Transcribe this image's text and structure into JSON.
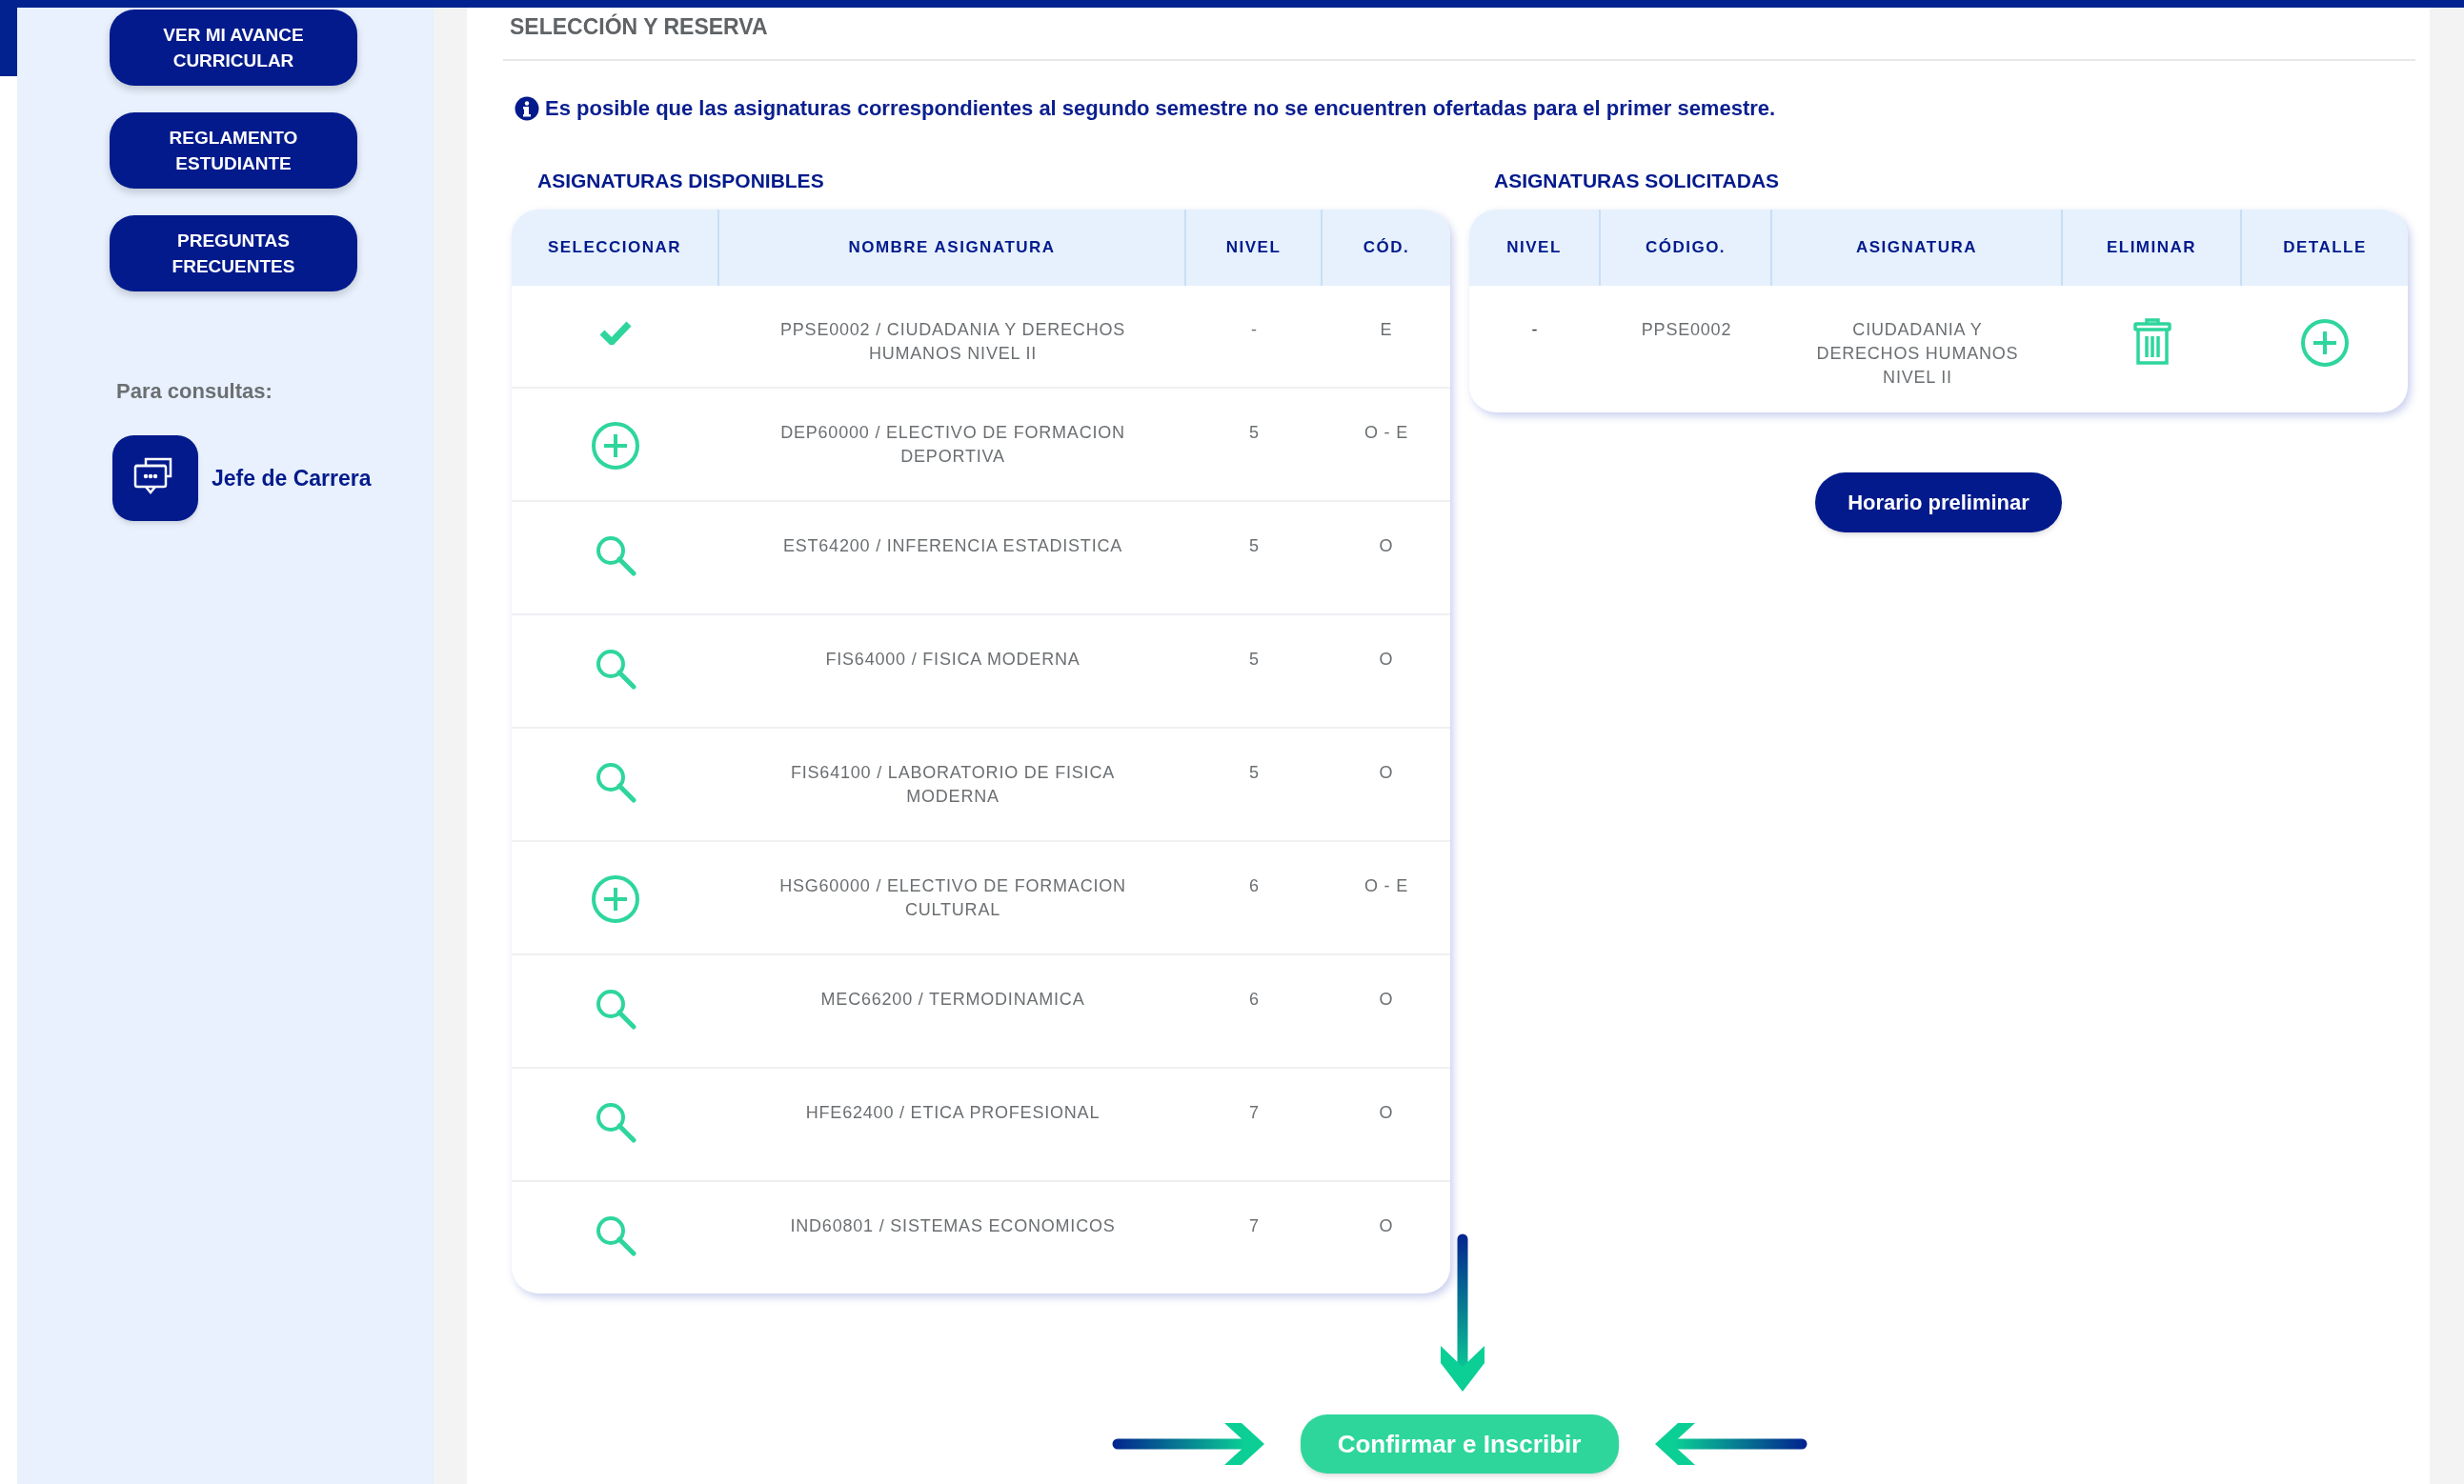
{
  "sidebar": {
    "buttons": [
      "VER MI AVANCE CURRICULAR",
      "REGLAMENTO ESTUDIANTE",
      "PREGUNTAS FRECUENTES"
    ],
    "contact_label": "Para consultas:",
    "contact": "Jefe de Carrera"
  },
  "heading": "SELECCIÓN Y RESERVA",
  "notice": "Es posible que las asignaturas correspondientes al segundo semestre no se encuentren ofertadas para el primer semestre.",
  "available": {
    "title": "ASIGNATURAS DISPONIBLES",
    "columns": [
      "SELECCIONAR",
      "NOMBRE ASIGNATURA",
      "NIVEL",
      "CÓD."
    ],
    "rows": [
      {
        "kind": "check",
        "name": "PPSE0002 / CIUDADANIA Y DERECHOS HUMANOS NIVEL II",
        "level": "-",
        "code": "E"
      },
      {
        "kind": "add",
        "name": "DEP60000 / ELECTIVO DE FORMACION DEPORTIVA",
        "level": "5",
        "code": "O - E"
      },
      {
        "kind": "search",
        "name": "EST64200 / INFERENCIA ESTADISTICA",
        "level": "5",
        "code": "O"
      },
      {
        "kind": "search",
        "name": "FIS64000 / FISICA MODERNA",
        "level": "5",
        "code": "O"
      },
      {
        "kind": "search",
        "name": "FIS64100 / LABORATORIO DE FISICA MODERNA",
        "level": "5",
        "code": "O"
      },
      {
        "kind": "add",
        "name": "HSG60000 / ELECTIVO DE FORMACION CULTURAL",
        "level": "6",
        "code": "O - E"
      },
      {
        "kind": "search",
        "name": "MEC66200 / TERMODINAMICA",
        "level": "6",
        "code": "O"
      },
      {
        "kind": "search",
        "name": "HFE62400 / ETICA PROFESIONAL",
        "level": "7",
        "code": "O"
      },
      {
        "kind": "search",
        "name": "IND60801 / SISTEMAS ECONOMICOS",
        "level": "7",
        "code": "O"
      }
    ]
  },
  "requested": {
    "title": "ASIGNATURAS SOLICITADAS",
    "columns": [
      "NIVEL",
      "CÓDIGO.",
      "ASIGNATURA",
      "ELIMINAR",
      "DETALLE"
    ],
    "rows": [
      {
        "level": "-",
        "code": "PPSE0002",
        "name": "CIUDADANIA Y DERECHOS HUMANOS NIVEL II"
      }
    ]
  },
  "schedule_button": "Horario preliminar",
  "confirm_button": "Confirmar e Inscribir"
}
